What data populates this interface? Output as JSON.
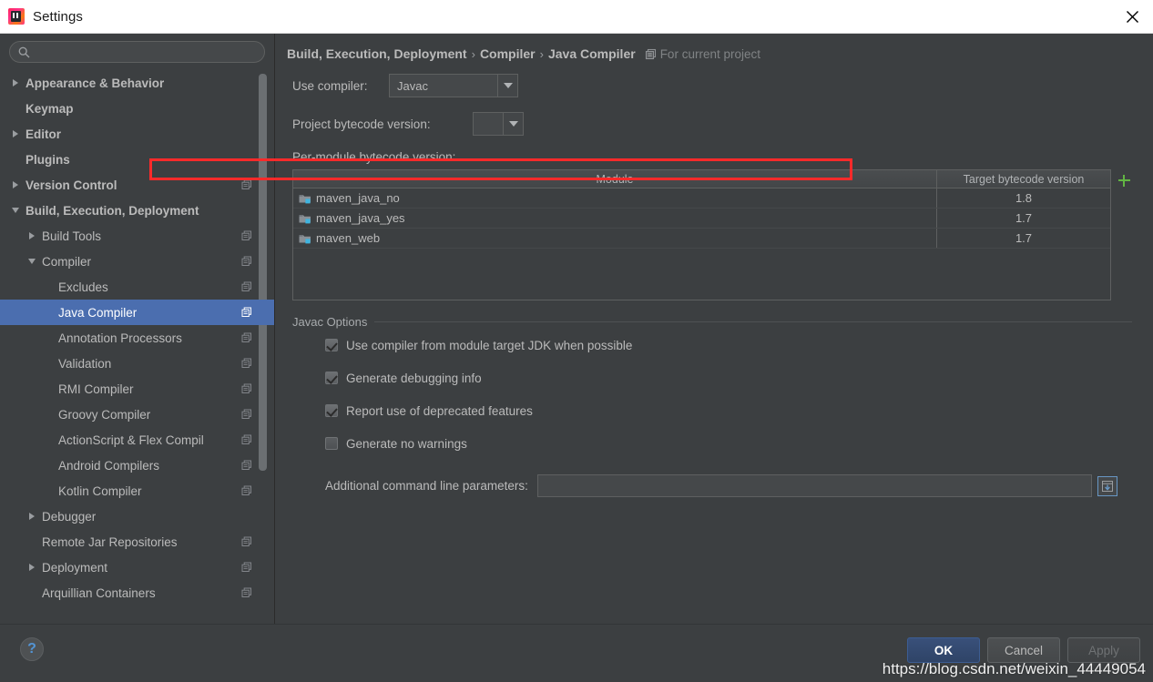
{
  "window": {
    "title": "Settings",
    "logo_icon": "intellij-idea-logo",
    "close_icon": "close-icon"
  },
  "sidebar": {
    "search": {
      "value": "",
      "placeholder": "",
      "icon": "search-icon"
    },
    "items": [
      {
        "label": "Appearance & Behavior",
        "indent": 0,
        "twisty": "right",
        "bold": true,
        "cfg": false,
        "selected": false
      },
      {
        "label": "Keymap",
        "indent": 0,
        "twisty": "none",
        "bold": true,
        "cfg": false,
        "selected": false
      },
      {
        "label": "Editor",
        "indent": 0,
        "twisty": "right",
        "bold": true,
        "cfg": false,
        "selected": false
      },
      {
        "label": "Plugins",
        "indent": 0,
        "twisty": "none",
        "bold": true,
        "cfg": false,
        "selected": false
      },
      {
        "label": "Version Control",
        "indent": 0,
        "twisty": "right",
        "bold": true,
        "cfg": true,
        "selected": false
      },
      {
        "label": "Build, Execution, Deployment",
        "indent": 0,
        "twisty": "down",
        "bold": true,
        "cfg": false,
        "selected": false
      },
      {
        "label": "Build Tools",
        "indent": 1,
        "twisty": "right",
        "bold": false,
        "cfg": true,
        "selected": false
      },
      {
        "label": "Compiler",
        "indent": 1,
        "twisty": "down",
        "bold": false,
        "cfg": true,
        "selected": false
      },
      {
        "label": "Excludes",
        "indent": 2,
        "twisty": "none",
        "bold": false,
        "cfg": true,
        "selected": false
      },
      {
        "label": "Java Compiler",
        "indent": 2,
        "twisty": "none",
        "bold": false,
        "cfg": true,
        "selected": true
      },
      {
        "label": "Annotation Processors",
        "indent": 2,
        "twisty": "none",
        "bold": false,
        "cfg": true,
        "selected": false
      },
      {
        "label": "Validation",
        "indent": 2,
        "twisty": "none",
        "bold": false,
        "cfg": true,
        "selected": false
      },
      {
        "label": "RMI Compiler",
        "indent": 2,
        "twisty": "none",
        "bold": false,
        "cfg": true,
        "selected": false
      },
      {
        "label": "Groovy Compiler",
        "indent": 2,
        "twisty": "none",
        "bold": false,
        "cfg": true,
        "selected": false
      },
      {
        "label": "ActionScript & Flex Compil",
        "indent": 2,
        "twisty": "none",
        "bold": false,
        "cfg": true,
        "selected": false
      },
      {
        "label": "Android Compilers",
        "indent": 2,
        "twisty": "none",
        "bold": false,
        "cfg": true,
        "selected": false
      },
      {
        "label": "Kotlin Compiler",
        "indent": 2,
        "twisty": "none",
        "bold": false,
        "cfg": true,
        "selected": false
      },
      {
        "label": "Debugger",
        "indent": 1,
        "twisty": "right",
        "bold": false,
        "cfg": false,
        "selected": false
      },
      {
        "label": "Remote Jar Repositories",
        "indent": 1,
        "twisty": "none",
        "bold": false,
        "cfg": true,
        "selected": false
      },
      {
        "label": "Deployment",
        "indent": 1,
        "twisty": "right",
        "bold": false,
        "cfg": true,
        "selected": false
      },
      {
        "label": "Arquillian Containers",
        "indent": 1,
        "twisty": "none",
        "bold": false,
        "cfg": true,
        "selected": false
      }
    ]
  },
  "main": {
    "breadcrumb": [
      "Build, Execution, Deployment",
      "Compiler",
      "Java Compiler"
    ],
    "breadcrumb_separator": "›",
    "scope_label": "For current project",
    "scope_icon": "project-scope-icon",
    "use_compiler": {
      "label": "Use compiler:",
      "value": "Javac"
    },
    "project_bytecode": {
      "label": "Project bytecode version:",
      "value": ""
    },
    "per_module_label": "Per-module bytecode version:",
    "table": {
      "columns": [
        "Module",
        "Target bytecode version"
      ],
      "rows": [
        {
          "module": "maven_java_no",
          "target": "1.8"
        },
        {
          "module": "maven_java_yes",
          "target": "1.7"
        },
        {
          "module": "maven_web",
          "target": "1.7"
        }
      ],
      "add_icon": "plus-icon"
    },
    "javac_options": {
      "title": "Javac Options",
      "checkboxes": [
        {
          "label": "Use compiler from module target JDK when possible",
          "checked": true
        },
        {
          "label": "Generate debugging info",
          "checked": true
        },
        {
          "label": "Report use of deprecated features",
          "checked": true
        },
        {
          "label": "Generate no warnings",
          "checked": false
        }
      ],
      "additional_params": {
        "label": "Additional command line parameters:",
        "value": "",
        "placeholder": "",
        "expand_icon": "expand-editor-icon"
      }
    }
  },
  "footer": {
    "help_label": "?",
    "help_icon": "help-icon",
    "buttons": [
      {
        "label": "OK",
        "state": "default"
      },
      {
        "label": "Cancel",
        "state": "normal"
      },
      {
        "label": "Apply",
        "state": "disabled"
      }
    ]
  },
  "watermark": "https://blog.csdn.net/weixin_44449054",
  "colors": {
    "background": "#3c3f41",
    "selection": "#4b6eaf",
    "accent_green": "#62b543",
    "annotation_red": "#ff2a2a",
    "text": "#bbbbbb"
  }
}
